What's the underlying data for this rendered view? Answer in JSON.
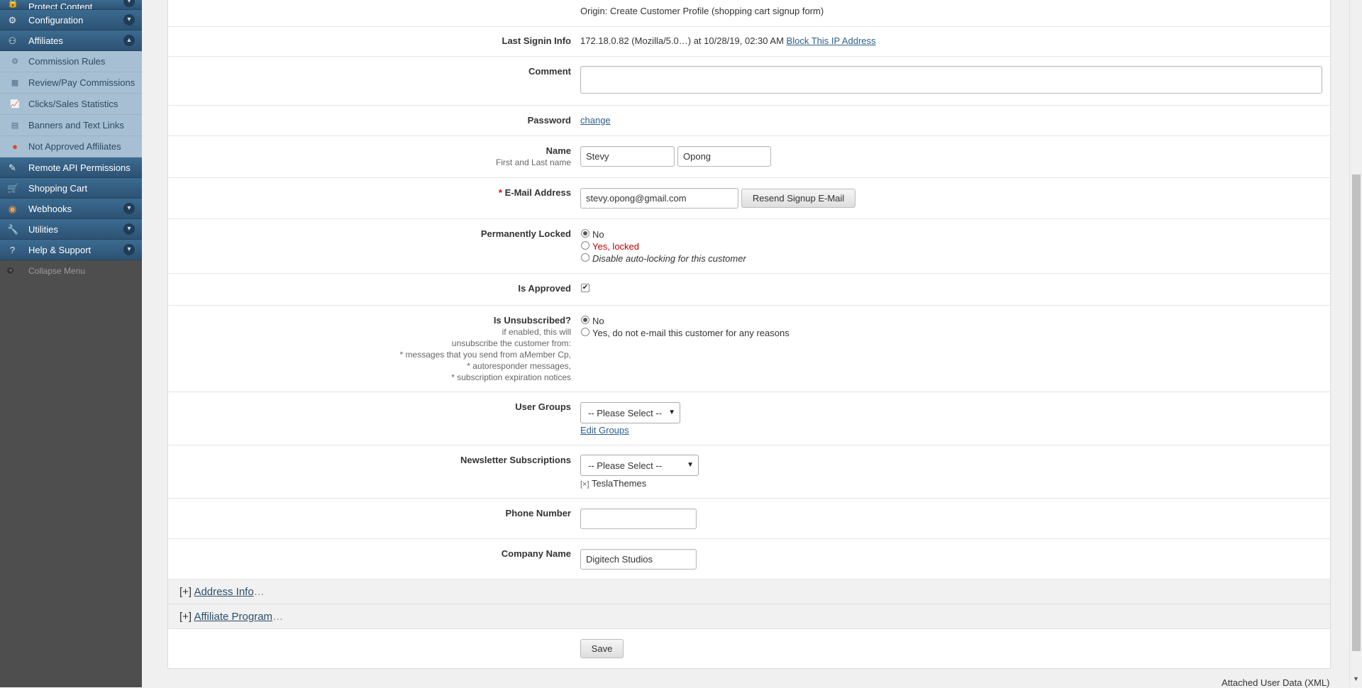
{
  "sidebar": {
    "items": [
      {
        "label": "Protect Content",
        "icon": "lock-icon",
        "expandable": true
      },
      {
        "label": "Configuration",
        "icon": "gear-icon",
        "expandable": true
      },
      {
        "label": "Affiliates",
        "icon": "hierarchy-icon",
        "expandable": true,
        "expanded": true
      }
    ],
    "sub_items": [
      {
        "label": "Commission Rules",
        "icon": "gear-icon"
      },
      {
        "label": "Review/Pay Commissions",
        "icon": "table-icon"
      },
      {
        "label": "Clicks/Sales Statistics",
        "icon": "chart-icon"
      },
      {
        "label": "Banners and Text Links",
        "icon": "grid-icon"
      },
      {
        "label": "Not Approved Affiliates",
        "icon": "alert-dot-icon"
      }
    ],
    "items_after": [
      {
        "label": "Remote API Permissions",
        "icon": "plug-icon",
        "expandable": false
      },
      {
        "label": "Shopping Cart",
        "icon": "cart-icon",
        "expandable": false
      },
      {
        "label": "Webhooks",
        "icon": "webhook-icon",
        "expandable": true
      },
      {
        "label": "Utilities",
        "icon": "wrench-icon",
        "expandable": true
      },
      {
        "label": "Help & Support",
        "icon": "help-icon",
        "expandable": true
      }
    ],
    "collapse_label": "Collapse Menu"
  },
  "form": {
    "origin_text": "Origin: Create Customer Profile (shopping cart signup form)",
    "last_signin": {
      "label": "Last Signin Info",
      "value": "172.18.0.82 (Mozilla/5.0…) at 10/28/19, 02:30 AM",
      "link": "Block This IP Address"
    },
    "comment": {
      "label": "Comment",
      "value": ""
    },
    "password": {
      "label": "Password",
      "link": "change"
    },
    "name": {
      "label": "Name",
      "note": "First and Last name",
      "first": "Stevy",
      "last": "Opong"
    },
    "email": {
      "label": "E-Mail Address",
      "required_mark": "*",
      "value": "stevy.opong@gmail.com",
      "button": "Resend Signup E-Mail"
    },
    "locked": {
      "label": "Permanently Locked",
      "options": [
        "No",
        "Yes, locked",
        "Disable auto-locking for this customer"
      ],
      "selected": 0
    },
    "approved": {
      "label": "Is Approved",
      "checked": true
    },
    "unsubscribed": {
      "label": "Is Unsubscribed?",
      "notes": [
        "if enabled, this will",
        "unsubscribe the customer from:",
        "* messages that you send from aMember Cp,",
        "* autoresponder messages,",
        "* subscription expiration notices"
      ],
      "options": [
        "No",
        "Yes, do not e-mail this customer for any reasons"
      ],
      "selected": 0
    },
    "user_groups": {
      "label": "User Groups",
      "select": "-- Please Select --",
      "link": "Edit Groups"
    },
    "newsletter": {
      "label": "Newsletter Subscriptions",
      "select": "-- Please Select --",
      "remove_mark": "[×]",
      "tag": "TeslaThemes"
    },
    "phone": {
      "label": "Phone Number",
      "value": ""
    },
    "company": {
      "label": "Company Name",
      "value": "Digitech Studios"
    },
    "sections": [
      {
        "toggle": "[+]",
        "title": "Address Info",
        "ellipsis": "…"
      },
      {
        "toggle": "[+]",
        "title": "Affiliate Program",
        "ellipsis": "…"
      }
    ],
    "save_label": "Save"
  },
  "footer": {
    "link": "Attached User Data (XML)"
  },
  "colors": {
    "menu_bg": "#2f5577",
    "submenu_bg": "#a6bfd2",
    "sidebar_bg": "#4e4e4e",
    "link": "#2d5e8c",
    "required": "#d40000",
    "locked_red": "#c00000"
  }
}
